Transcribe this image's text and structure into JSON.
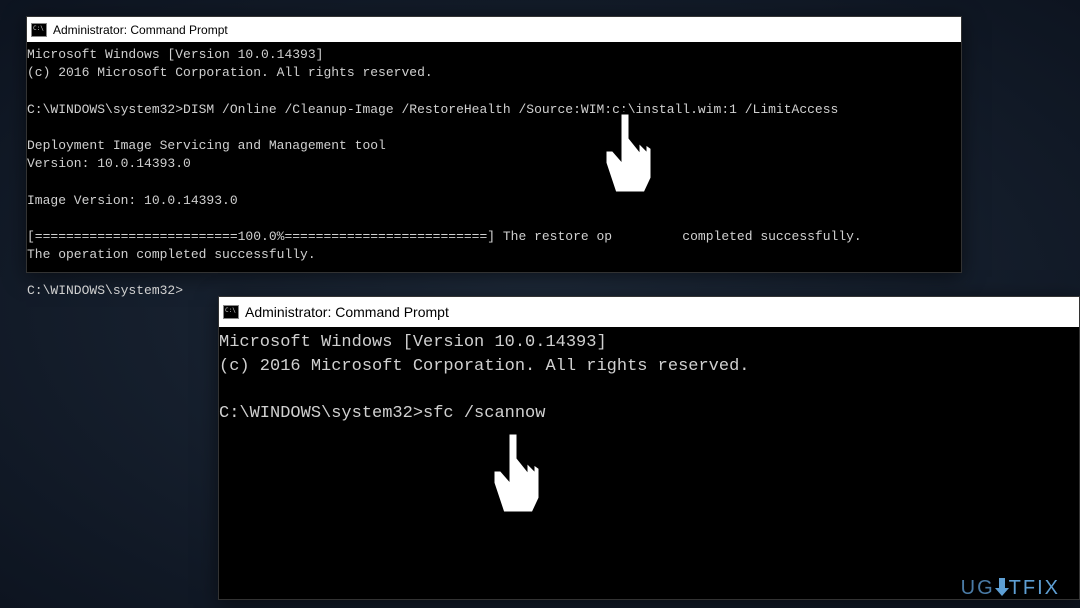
{
  "window1": {
    "title": "Administrator: Command Prompt",
    "lines": {
      "l0": "Microsoft Windows [Version 10.0.14393]",
      "l1": "(c) 2016 Microsoft Corporation. All rights reserved.",
      "l2": "",
      "l3": "C:\\WINDOWS\\system32>DISM /Online /Cleanup-Image /RestoreHealth /Source:WIM:c:\\install.wim:1 /LimitAccess",
      "l4": "",
      "l5": "Deployment Image Servicing and Management tool",
      "l6": "Version: 10.0.14393.0",
      "l7": "",
      "l8": "Image Version: 10.0.14393.0",
      "l9": "",
      "l10": "[==========================100.0%==========================] The restore op         completed successfully.",
      "l11": "The operation completed successfully.",
      "l12": "",
      "l13": "C:\\WINDOWS\\system32>"
    }
  },
  "window2": {
    "title": "Administrator: Command Prompt",
    "lines": {
      "l0": "Microsoft Windows [Version 10.0.14393]",
      "l1": "(c) 2016 Microsoft Corporation. All rights reserved.",
      "l2": "",
      "l3": "C:\\WINDOWS\\system32>sfc /scannow"
    }
  },
  "watermark": {
    "part1": "UG",
    "part2": "TFIX"
  }
}
